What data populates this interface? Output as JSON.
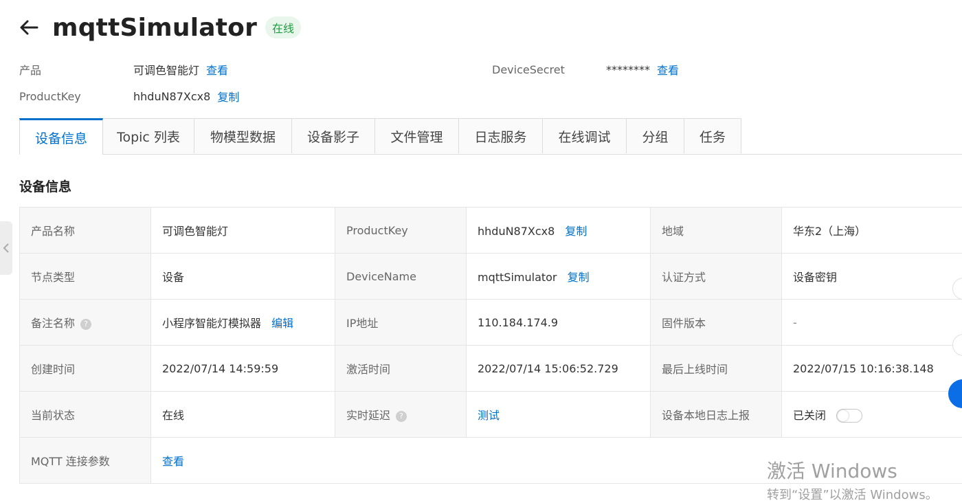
{
  "header": {
    "title": "mqttSimulator",
    "status": "在线"
  },
  "meta": {
    "product_label": "产品",
    "product_value": "可调色智能灯",
    "product_link": "查看",
    "productkey_label": "ProductKey",
    "productkey_value": "hhduN87Xcx8",
    "productkey_link": "复制",
    "secret_label": "DeviceSecret",
    "secret_value": "********",
    "secret_link": "查看"
  },
  "tabs": [
    {
      "label": "设备信息"
    },
    {
      "label": "Topic 列表"
    },
    {
      "label": "物模型数据"
    },
    {
      "label": "设备影子"
    },
    {
      "label": "文件管理"
    },
    {
      "label": "日志服务"
    },
    {
      "label": "在线调试"
    },
    {
      "label": "分组"
    },
    {
      "label": "任务"
    }
  ],
  "section": {
    "title": "设备信息"
  },
  "table": {
    "r1": {
      "l1": "产品名称",
      "v1": "可调色智能灯",
      "l2": "ProductKey",
      "v2": "hhduN87Xcx8",
      "v2_link": "复制",
      "l3": "地域",
      "v3": "华东2（上海）"
    },
    "r2": {
      "l1": "节点类型",
      "v1": "设备",
      "l2": "DeviceName",
      "v2": "mqttSimulator",
      "v2_link": "复制",
      "l3": "认证方式",
      "v3": "设备密钥"
    },
    "r3": {
      "l1": "备注名称",
      "v1": "小程序智能灯模拟器",
      "v1_link": "编辑",
      "l2": "IP地址",
      "v2": "110.184.174.9",
      "l3": "固件版本",
      "v3": "-"
    },
    "r4": {
      "l1": "创建时间",
      "v1": "2022/07/14 14:59:59",
      "l2": "激活时间",
      "v2": "2022/07/14 15:06:52.729",
      "l3": "最后上线时间",
      "v3": "2022/07/15 10:16:38.148"
    },
    "r5": {
      "l1": "当前状态",
      "v1": "在线",
      "l2": "实时延迟",
      "v2_link": "测试",
      "l3": "设备本地日志上报",
      "v3": "已关闭"
    },
    "r6": {
      "l1": "MQTT 连接参数",
      "v1_link": "查看"
    }
  },
  "watermark": {
    "line1": "激活 Windows",
    "line2": "转到“设置”以激活 Windows。"
  },
  "icons": [
    "arrow-left-icon",
    "question-icon",
    "chevron-left-icon"
  ],
  "colors": {
    "accent": "#0070cc",
    "online_text": "#1e9e3e",
    "online_bg": "#e9f6ec"
  }
}
